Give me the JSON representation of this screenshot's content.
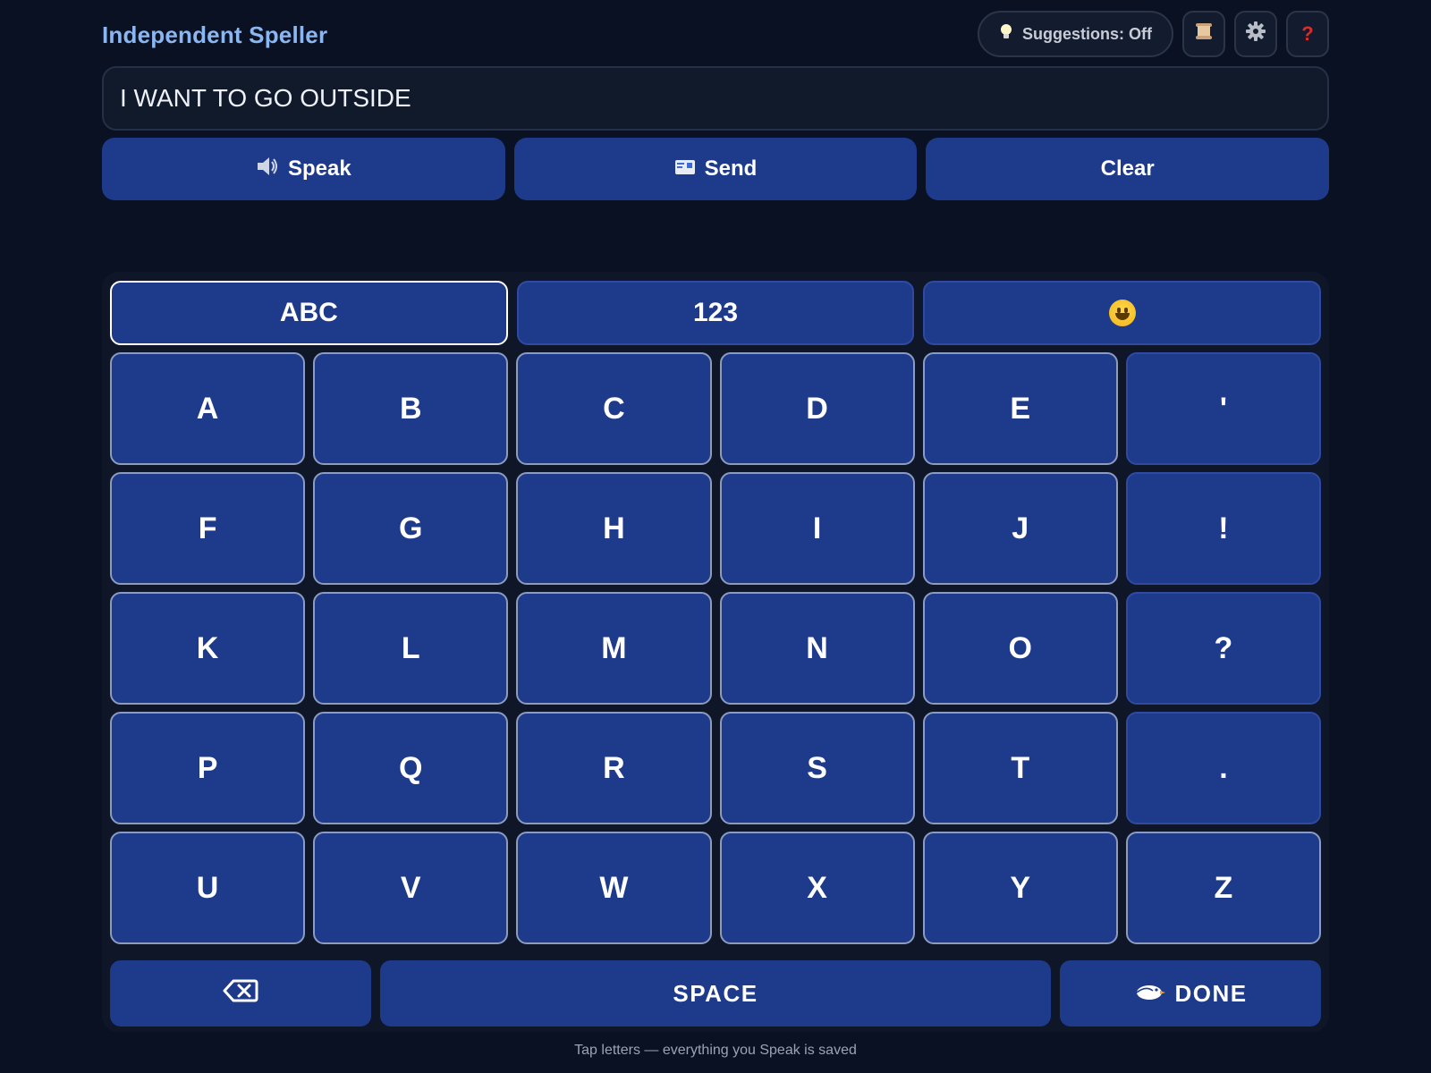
{
  "app": {
    "title": "Independent Speller"
  },
  "header": {
    "suggestions_label": "Suggestions: Off",
    "history_icon": "scroll-icon",
    "settings_icon": "gear-icon",
    "help_icon": "question-icon"
  },
  "text_display": {
    "value": "I WANT TO GO OUTSIDE"
  },
  "actions": {
    "speak_label": "Speak",
    "send_label": "Send",
    "clear_label": "Clear"
  },
  "keyboard": {
    "modes": [
      {
        "label": "ABC",
        "active": true
      },
      {
        "label": "123",
        "active": false
      },
      {
        "icon": "emoji-smiley-icon",
        "active": false
      }
    ],
    "keys": [
      "A",
      "B",
      "C",
      "D",
      "E",
      "'",
      "F",
      "G",
      "H",
      "I",
      "J",
      "!",
      "K",
      "L",
      "M",
      "N",
      "O",
      "?",
      "P",
      "Q",
      "R",
      "S",
      "T",
      ".",
      "U",
      "V",
      "W",
      "X",
      "Y",
      "Z"
    ],
    "space_label": "SPACE",
    "done_label": "DONE",
    "backspace_icon": "backspace-icon",
    "done_icon": "bird-icon"
  },
  "footer": {
    "note": "Tap letters — everything you Speak is saved"
  },
  "colors": {
    "background": "#0a1122",
    "key": "#1e3a8a",
    "title": "#8ab6f2"
  }
}
